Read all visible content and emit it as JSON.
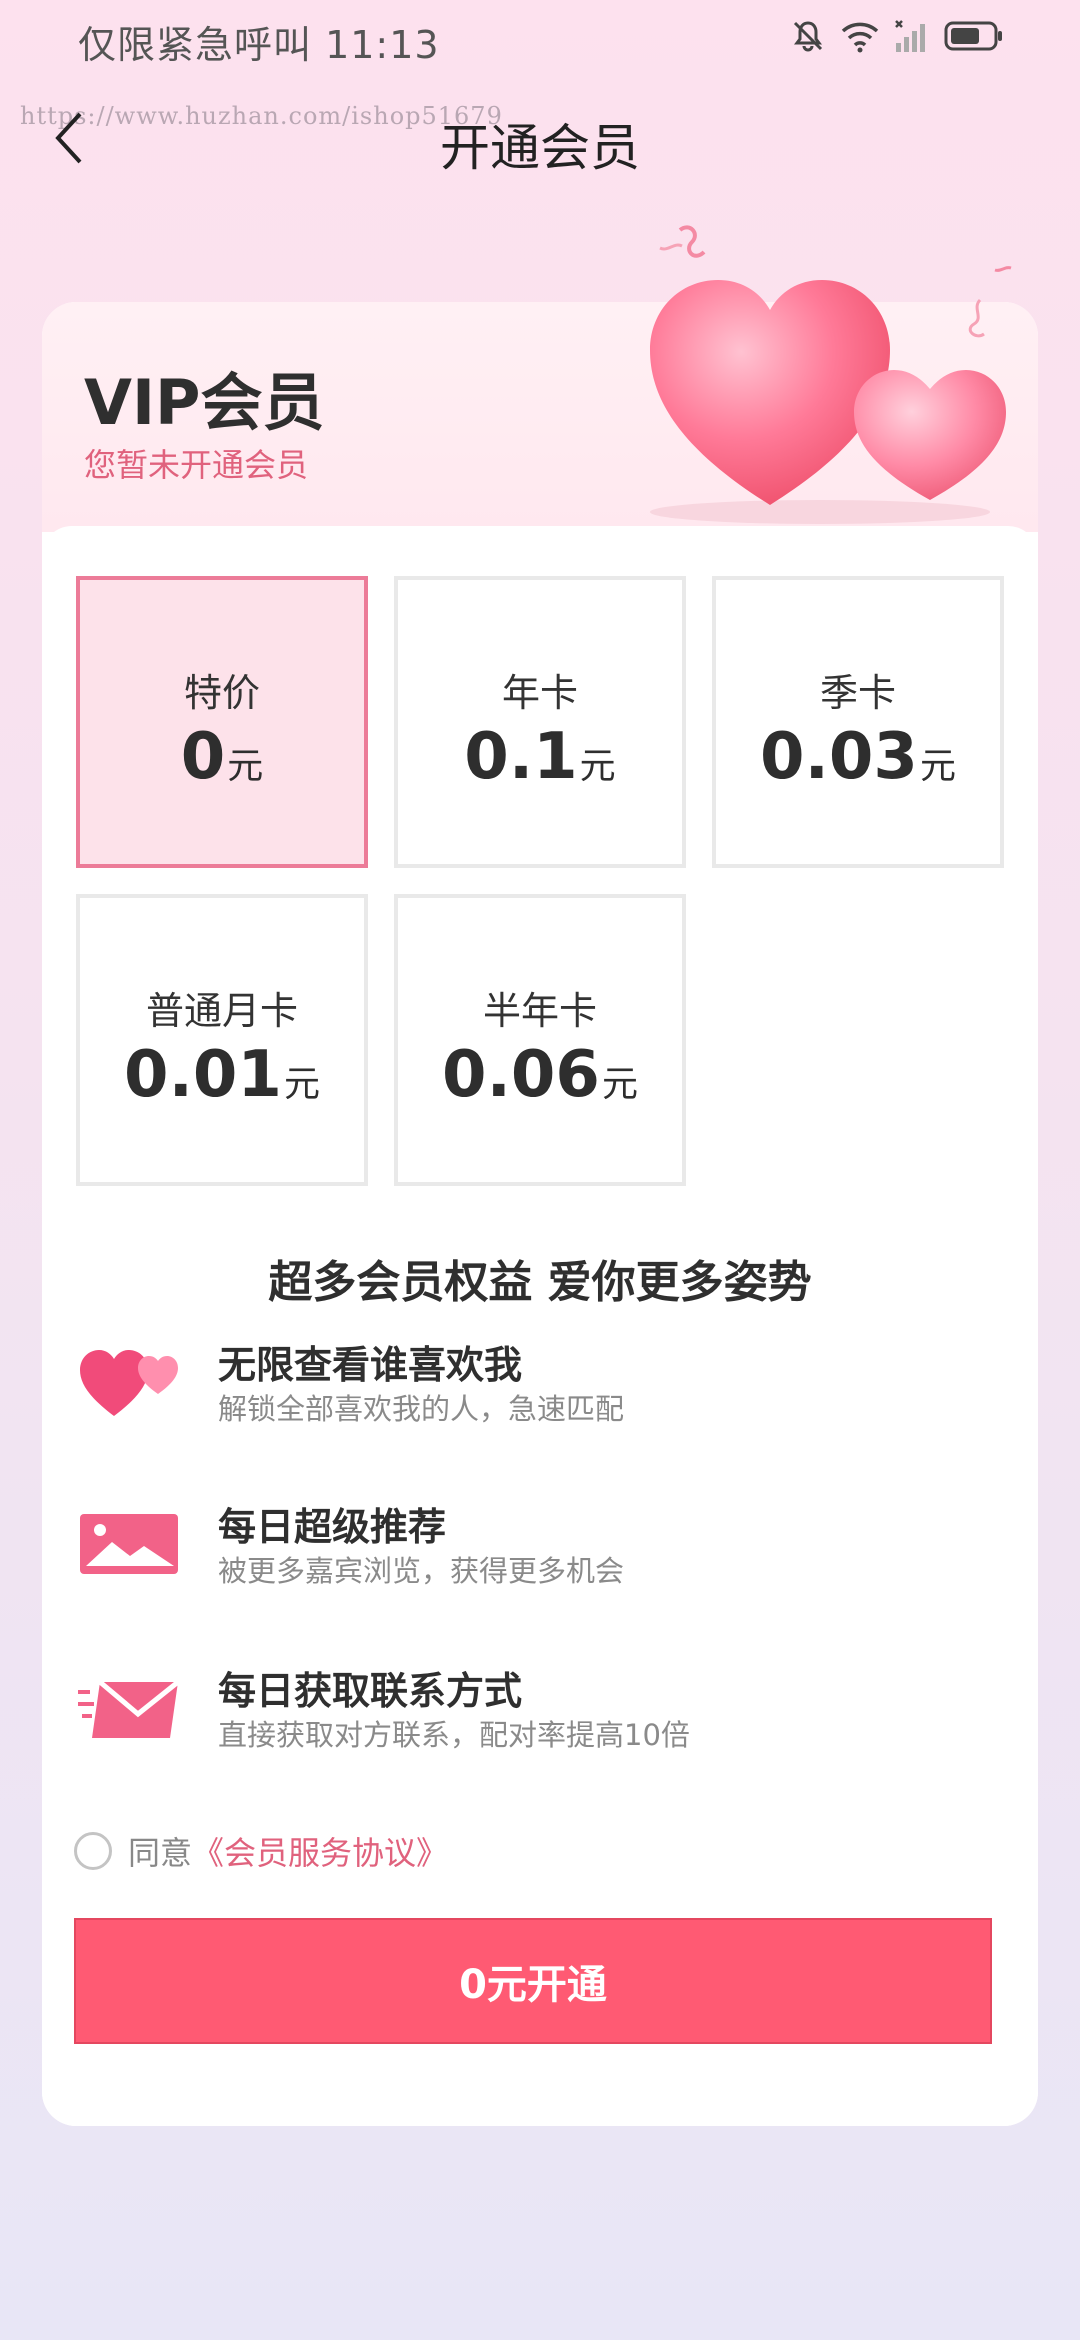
{
  "status_bar": {
    "left_text": "仅限紧急呼叫 11:13",
    "icons": [
      "bell-off-icon",
      "wifi-icon",
      "signal-icon",
      "battery-icon"
    ]
  },
  "watermark": "https://www.huzhan.com/ishop51679",
  "nav": {
    "title": "开通会员",
    "back_icon": "chevron-left-icon"
  },
  "vip": {
    "title": "VIP会员",
    "subtitle": "您暂未开通会员"
  },
  "plans": [
    {
      "name": "特价",
      "price": "0",
      "unit": "元",
      "selected": true
    },
    {
      "name": "年卡",
      "price": "0.1",
      "unit": "元",
      "selected": false
    },
    {
      "name": "季卡",
      "price": "0.03",
      "unit": "元",
      "selected": false
    },
    {
      "name": "普通月卡",
      "price": "0.01",
      "unit": "元",
      "selected": false
    },
    {
      "name": "半年卡",
      "price": "0.06",
      "unit": "元",
      "selected": false
    }
  ],
  "benefits_title": "超多会员权益 爱你更多姿势",
  "benefits": [
    {
      "icon": "hearts-icon",
      "title": "无限查看谁喜欢我",
      "desc": "解锁全部喜欢我的人，急速匹配"
    },
    {
      "icon": "image-icon",
      "title": "每日超级推荐",
      "desc": "被更多嘉宾浏览，获得更多机会"
    },
    {
      "icon": "envelope-icon",
      "title": "每日获取联系方式",
      "desc": "直接获取对方联系，配对率提高10倍"
    }
  ],
  "agreement": {
    "prefix": "同意",
    "link": "《会员服务协议》",
    "checked": false
  },
  "cta_label": "0元开通",
  "colors": {
    "accent": "#ff5a73",
    "pink_text": "#e0627d",
    "selected_border": "#ec7b98",
    "selected_bg": "#fde2ea"
  }
}
